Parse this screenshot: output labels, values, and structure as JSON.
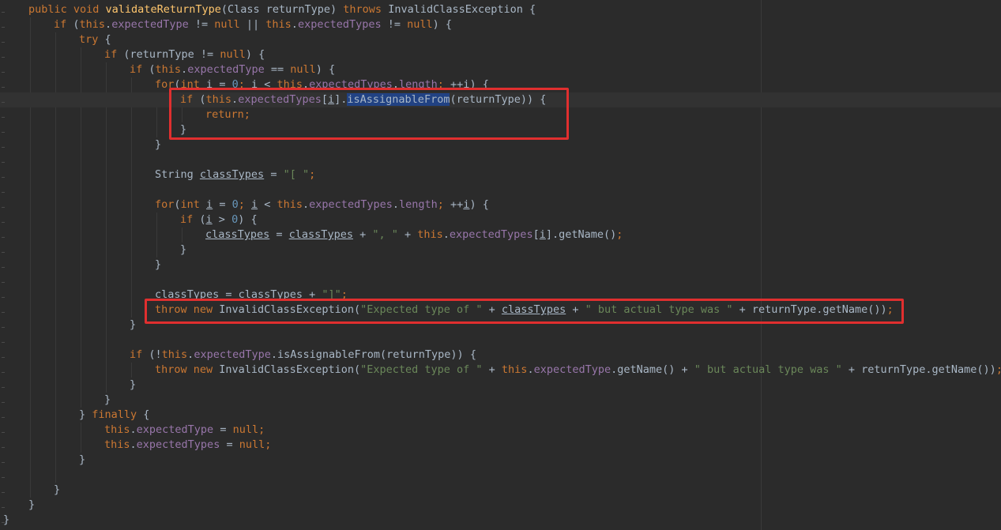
{
  "editor": {
    "colors": {
      "background": "#2b2b2b",
      "keyword": "#cc7832",
      "method_declaration": "#ffc66d",
      "field": "#9876aa",
      "string": "#6a8759",
      "number": "#6897bb",
      "text": "#a9b7c6",
      "selection": "#214283",
      "annotation_box": "#e02f2f"
    },
    "lines": [
      {
        "indent": 1,
        "tokens": [
          [
            "kw",
            "public void "
          ],
          [
            "fn",
            "validateReturnType"
          ],
          [
            "p",
            "(Class returnType) "
          ],
          [
            "kw",
            "throws "
          ],
          [
            "p",
            "InvalidClassException {"
          ]
        ]
      },
      {
        "indent": 2,
        "tokens": [
          [
            "kw",
            "if "
          ],
          [
            "p",
            "("
          ],
          [
            "kw",
            "this"
          ],
          [
            "p",
            "."
          ],
          [
            "fld",
            "expectedType"
          ],
          [
            "p",
            " != "
          ],
          [
            "kw",
            "null"
          ],
          [
            "p",
            " || "
          ],
          [
            "kw",
            "this"
          ],
          [
            "p",
            "."
          ],
          [
            "fld",
            "expectedTypes"
          ],
          [
            "p",
            " != "
          ],
          [
            "kw",
            "null"
          ],
          [
            "p",
            ") {"
          ]
        ]
      },
      {
        "indent": 3,
        "tokens": [
          [
            "kw",
            "try "
          ],
          [
            "p",
            "{"
          ]
        ]
      },
      {
        "indent": 4,
        "tokens": [
          [
            "kw",
            "if "
          ],
          [
            "p",
            "(returnType != "
          ],
          [
            "kw",
            "null"
          ],
          [
            "p",
            ") {"
          ]
        ]
      },
      {
        "indent": 5,
        "tokens": [
          [
            "kw",
            "if "
          ],
          [
            "p",
            "("
          ],
          [
            "kw",
            "this"
          ],
          [
            "p",
            "."
          ],
          [
            "fld",
            "expectedType"
          ],
          [
            "p",
            " == "
          ],
          [
            "kw",
            "null"
          ],
          [
            "p",
            ") {"
          ]
        ]
      },
      {
        "indent": 6,
        "tokens": [
          [
            "kw",
            "for"
          ],
          [
            "p",
            "("
          ],
          [
            "kw",
            "int "
          ],
          [
            "var",
            "i"
          ],
          [
            "p",
            " = "
          ],
          [
            "num",
            "0"
          ],
          [
            "kw",
            "; "
          ],
          [
            "var",
            "i"
          ],
          [
            "p",
            " < "
          ],
          [
            "kw",
            "this"
          ],
          [
            "p",
            "."
          ],
          [
            "fld",
            "expectedTypes"
          ],
          [
            "p",
            "."
          ],
          [
            "fld",
            "length"
          ],
          [
            "kw",
            "; "
          ],
          [
            "p",
            "++"
          ],
          [
            "var",
            "i"
          ],
          [
            "p",
            ") {"
          ]
        ]
      },
      {
        "indent": 7,
        "current": true,
        "tokens": [
          [
            "kw",
            "if "
          ],
          [
            "p",
            "("
          ],
          [
            "kw",
            "this"
          ],
          [
            "p",
            "."
          ],
          [
            "fld",
            "expectedTypes"
          ],
          [
            "p",
            "["
          ],
          [
            "var",
            "i"
          ],
          [
            "p",
            "]."
          ],
          [
            "sel",
            "isAssignableFrom"
          ],
          [
            "p",
            "(returnType)) {"
          ]
        ]
      },
      {
        "indent": 8,
        "tokens": [
          [
            "kw",
            "return;"
          ]
        ]
      },
      {
        "indent": 7,
        "tokens": [
          [
            "p",
            "}"
          ]
        ]
      },
      {
        "indent": 6,
        "tokens": [
          [
            "p",
            "}"
          ]
        ]
      },
      {
        "indent": 0,
        "tokens": []
      },
      {
        "indent": 6,
        "tokens": [
          [
            "p",
            "String "
          ],
          [
            "var",
            "classTypes"
          ],
          [
            "p",
            " = "
          ],
          [
            "str",
            "\"[ \""
          ],
          [
            "kw",
            ";"
          ]
        ]
      },
      {
        "indent": 0,
        "tokens": []
      },
      {
        "indent": 6,
        "tokens": [
          [
            "kw",
            "for"
          ],
          [
            "p",
            "("
          ],
          [
            "kw",
            "int "
          ],
          [
            "var",
            "i"
          ],
          [
            "p",
            " = "
          ],
          [
            "num",
            "0"
          ],
          [
            "kw",
            "; "
          ],
          [
            "var",
            "i"
          ],
          [
            "p",
            " < "
          ],
          [
            "kw",
            "this"
          ],
          [
            "p",
            "."
          ],
          [
            "fld",
            "expectedTypes"
          ],
          [
            "p",
            "."
          ],
          [
            "fld",
            "length"
          ],
          [
            "kw",
            "; "
          ],
          [
            "p",
            "++"
          ],
          [
            "var",
            "i"
          ],
          [
            "p",
            ") {"
          ]
        ]
      },
      {
        "indent": 7,
        "tokens": [
          [
            "kw",
            "if "
          ],
          [
            "p",
            "("
          ],
          [
            "var",
            "i"
          ],
          [
            "p",
            " > "
          ],
          [
            "num",
            "0"
          ],
          [
            "p",
            ") {"
          ]
        ]
      },
      {
        "indent": 8,
        "tokens": [
          [
            "var",
            "classTypes"
          ],
          [
            "p",
            " = "
          ],
          [
            "var",
            "classTypes"
          ],
          [
            "p",
            " + "
          ],
          [
            "str",
            "\", \""
          ],
          [
            "p",
            " + "
          ],
          [
            "kw",
            "this"
          ],
          [
            "p",
            "."
          ],
          [
            "fld",
            "expectedTypes"
          ],
          [
            "p",
            "["
          ],
          [
            "var",
            "i"
          ],
          [
            "p",
            "].getName()"
          ],
          [
            "kw",
            ";"
          ]
        ]
      },
      {
        "indent": 7,
        "tokens": [
          [
            "p",
            "}"
          ]
        ]
      },
      {
        "indent": 6,
        "tokens": [
          [
            "p",
            "}"
          ]
        ]
      },
      {
        "indent": 0,
        "tokens": []
      },
      {
        "indent": 6,
        "tokens": [
          [
            "var",
            "classTypes"
          ],
          [
            "p",
            " = "
          ],
          [
            "var",
            "classTypes"
          ],
          [
            "p",
            " + "
          ],
          [
            "str",
            "\"]\""
          ],
          [
            "kw",
            ";"
          ]
        ]
      },
      {
        "indent": 6,
        "tokens": [
          [
            "kw",
            "throw new "
          ],
          [
            "p",
            "InvalidClassException("
          ],
          [
            "str",
            "\"Expected type of \""
          ],
          [
            "p",
            " + "
          ],
          [
            "var",
            "classTypes"
          ],
          [
            "p",
            " + "
          ],
          [
            "str",
            "\" but actual type was \""
          ],
          [
            "p",
            " + returnType.getName())"
          ],
          [
            "kw",
            ";"
          ]
        ]
      },
      {
        "indent": 5,
        "tokens": [
          [
            "p",
            "}"
          ]
        ]
      },
      {
        "indent": 0,
        "tokens": []
      },
      {
        "indent": 5,
        "tokens": [
          [
            "kw",
            "if "
          ],
          [
            "p",
            "(!"
          ],
          [
            "kw",
            "this"
          ],
          [
            "p",
            "."
          ],
          [
            "fld",
            "expectedType"
          ],
          [
            "p",
            ".isAssignableFrom(returnType)) {"
          ]
        ]
      },
      {
        "indent": 6,
        "tokens": [
          [
            "kw",
            "throw new "
          ],
          [
            "p",
            "InvalidClassException("
          ],
          [
            "str",
            "\"Expected type of \""
          ],
          [
            "p",
            " + "
          ],
          [
            "kw",
            "this"
          ],
          [
            "p",
            "."
          ],
          [
            "fld",
            "expectedType"
          ],
          [
            "p",
            ".getName() + "
          ],
          [
            "str",
            "\" but actual type was \""
          ],
          [
            "p",
            " + returnType.getName())"
          ],
          [
            "kw",
            ";"
          ]
        ]
      },
      {
        "indent": 5,
        "tokens": [
          [
            "p",
            "}"
          ]
        ]
      },
      {
        "indent": 4,
        "tokens": [
          [
            "p",
            "}"
          ]
        ]
      },
      {
        "indent": 3,
        "tokens": [
          [
            "p",
            "} "
          ],
          [
            "kw",
            "finally "
          ],
          [
            "p",
            "{"
          ]
        ]
      },
      {
        "indent": 4,
        "tokens": [
          [
            "kw",
            "this"
          ],
          [
            "p",
            "."
          ],
          [
            "fld",
            "expectedType"
          ],
          [
            "p",
            " = "
          ],
          [
            "kw",
            "null;"
          ]
        ]
      },
      {
        "indent": 4,
        "tokens": [
          [
            "kw",
            "this"
          ],
          [
            "p",
            "."
          ],
          [
            "fld",
            "expectedTypes"
          ],
          [
            "p",
            " = "
          ],
          [
            "kw",
            "null;"
          ]
        ]
      },
      {
        "indent": 3,
        "tokens": [
          [
            "p",
            "}"
          ]
        ]
      },
      {
        "indent": 0,
        "tokens": []
      },
      {
        "indent": 2,
        "tokens": [
          [
            "p",
            "}"
          ]
        ]
      },
      {
        "indent": 1,
        "tokens": [
          [
            "p",
            "}"
          ]
        ]
      },
      {
        "indent": 0,
        "tokens": [
          [
            "p",
            "}"
          ]
        ]
      }
    ]
  }
}
